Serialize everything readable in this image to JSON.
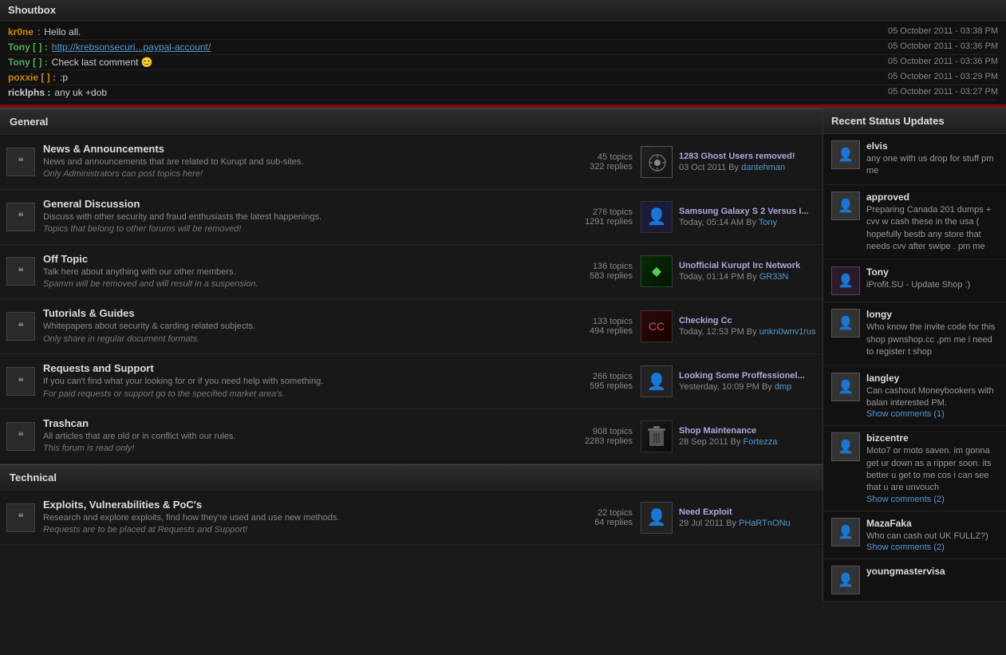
{
  "shoutbox": {
    "title": "Shoutbox",
    "messages": [
      {
        "user": "kr0ne",
        "userColor": "orange",
        "separator": ":",
        "text": "Hello all.",
        "time": "05 October 2011 - 03:38 PM"
      },
      {
        "user": "Tony [ ]",
        "userColor": "green",
        "separator": ":",
        "text": "",
        "link": "http://krebsonsecuri...paypal-account/",
        "time": "05 October 2011 - 03:36 PM"
      },
      {
        "user": "Tony [ ]",
        "userColor": "green",
        "separator": ":",
        "text": "Check last comment 😊",
        "time": "05 October 2011 - 03:36 PM"
      },
      {
        "user": "poxxie [ ]",
        "userColor": "orange",
        "separator": ":",
        "text": ":p",
        "time": "05 October 2011 - 03:29 PM"
      },
      {
        "user": "ricklphs",
        "userColor": "white",
        "separator": ":",
        "text": "any uk +dob",
        "time": "05 October 2011 - 03:27 PM"
      }
    ]
  },
  "sections": [
    {
      "name": "General",
      "categories": [
        {
          "id": "news",
          "title": "News & Announcements",
          "desc": "News and announcements that are related to Kurupt and sub-sites.",
          "desc2": "Only Administrators can post topics here!",
          "topics": "45 topics",
          "replies": "322 replies",
          "lastTitle": "1283 Ghost Users removed!",
          "lastDate": "03 Oct 2011",
          "lastBy": "dantehman",
          "avatarType": "target"
        },
        {
          "id": "general",
          "title": "General Discussion",
          "desc": "Discuss with other security and fraud enthusiasts the latest happenings.",
          "desc2": "Topics that belong to other forums will be removed!",
          "topics": "276 topics",
          "replies": "1291 replies",
          "lastTitle": "Samsung Galaxy S 2 Versus I...",
          "lastDate": "Today, 05:14 AM",
          "lastBy": "Tony",
          "avatarType": "person"
        },
        {
          "id": "offtopic",
          "title": "Off Topic",
          "desc": "Talk here about anything with our other members.",
          "desc2": "Spamm will be removed and will result in a suspension.",
          "topics": "136 topics",
          "replies": "583 replies",
          "lastTitle": "Unofficial Kurupt Irc Network",
          "lastDate": "Today, 01:14 PM",
          "lastBy": "GR33N",
          "avatarType": "green"
        },
        {
          "id": "tutorials",
          "title": "Tutorials & Guides",
          "desc": "Whitepapers about security & carding related subjects.",
          "desc2": "Only share in regular document formats.",
          "topics": "133 topics",
          "replies": "494 replies",
          "lastTitle": "Checking Cc",
          "lastDate": "Today, 12:53 PM",
          "lastBy": "unkn0wnv1rus",
          "avatarType": "red"
        },
        {
          "id": "requests",
          "title": "Requests and Support",
          "desc": "If you can't find what your looking for or if you need help with something.",
          "desc2": "For paid requests or support go to the specified market area's.",
          "topics": "266 topics",
          "replies": "595 replies",
          "lastTitle": "Looking Some Proffessionel...",
          "lastDate": "Yesterday, 10:09 PM",
          "lastBy": "dmp",
          "avatarType": "person"
        },
        {
          "id": "trashcan",
          "title": "Trashcan",
          "desc": "All articles that are old or in conflict with our rules.",
          "desc2": "This forum is read only!",
          "topics": "908 topics",
          "replies": "2283 replies",
          "lastTitle": "Shop Maintenance",
          "lastDate": "28 Sep 2011",
          "lastBy": "Fortezza",
          "avatarType": "dark"
        }
      ]
    },
    {
      "name": "Technical",
      "categories": [
        {
          "id": "exploits",
          "title": "Exploits, Vulnerabilities & PoC's",
          "desc": "Research and explore exploits, find how they're used and use new methods.",
          "desc2": "Requests are to be placed at Requests and Support!",
          "topics": "22 topics",
          "replies": "64 replies",
          "lastTitle": "Need Exploit",
          "lastDate": "29 Jul 2011",
          "lastBy": "PHaRTnONu",
          "avatarType": "person"
        }
      ]
    }
  ],
  "sidebar": {
    "title": "Recent Status Updates",
    "items": [
      {
        "user": "elvis",
        "text": "any one with us drop for stuff pm me",
        "showComments": ""
      },
      {
        "user": "approved",
        "text": "Preparing Canada 201 dumps + cvv w cash these in the usa ( hopefully bestb any store that needs cvv after swipe . pm me",
        "showComments": ""
      },
      {
        "user": "Tony",
        "text": "iProfit.SU - Update Shop :)",
        "showComments": ""
      },
      {
        "user": "longy",
        "text": "Who know the invite code for this shop pwnshop.cc ,pm me i need to register t shop",
        "showComments": ""
      },
      {
        "user": "langley",
        "text": "Can cashout Moneybookers with balan interested PM.",
        "showComments": "Show comments (1)"
      },
      {
        "user": "bizcentre",
        "text": "Moto7 or moto saven. im gonna get ur down as a ripper soon. its better u get to me cos i can see that u are unvouch",
        "showComments": "Show comments (2)"
      },
      {
        "user": "MazaFaka",
        "text": "Who can cash out UK FULLZ?)",
        "showComments": "Show comments (2)"
      },
      {
        "user": "youngmastervisa",
        "text": "",
        "showComments": ""
      }
    ]
  }
}
